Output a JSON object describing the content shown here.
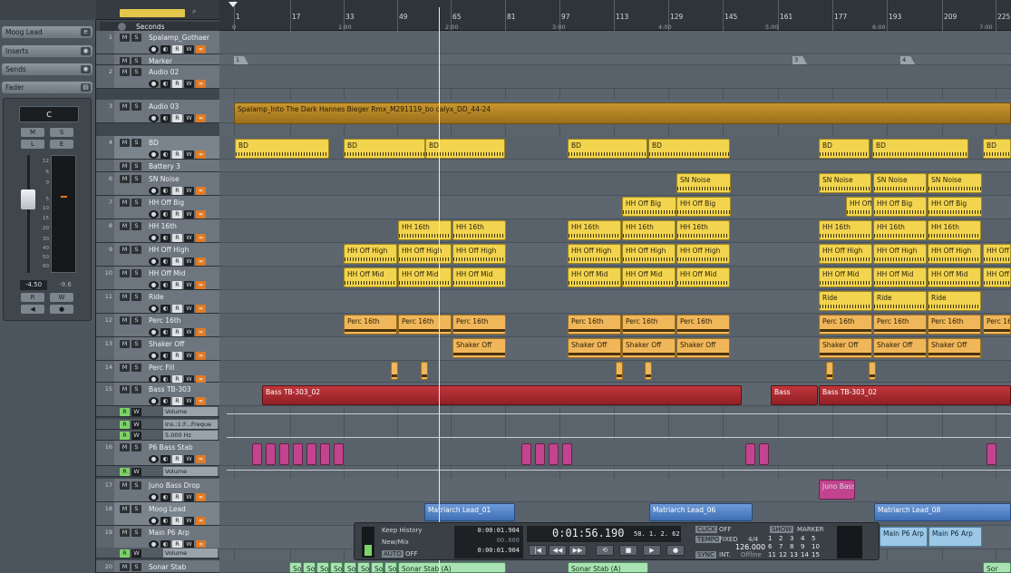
{
  "inspector": {
    "track_name": "Moog Lead",
    "sections": [
      "Inserts",
      "Sends",
      "Fader"
    ],
    "pan_value": "C",
    "mute": "M",
    "solo": "S",
    "listen": "L",
    "edit": "E",
    "scale": [
      "12",
      "6",
      "0",
      "5",
      "10",
      "15",
      "20",
      "30",
      "40",
      "50",
      "60"
    ],
    "volume_value": "-4.50",
    "peak_value": "-9.6",
    "read": "R",
    "write": "W",
    "level_percent": 45
  },
  "toolbar": {
    "seconds_label": "Seconds"
  },
  "ruler": {
    "bars": [
      "1",
      "17",
      "33",
      "49",
      "65",
      "81",
      "97",
      "113",
      "129",
      "145",
      "161",
      "177",
      "193",
      "209",
      "225"
    ],
    "seconds": [
      "0",
      "1:00",
      "2:00",
      "3:00",
      "4:00",
      "5:00",
      "6:00",
      "7:00"
    ]
  },
  "tracks": [
    {
      "num": "1",
      "name": "Spalamp_Gothaer",
      "sel": false
    },
    {
      "num": "",
      "name": "Marker",
      "sel": false
    },
    {
      "num": "2",
      "name": "Audio 02",
      "sel": false
    },
    {
      "num": "3",
      "name": "Audio 03",
      "sel": false
    },
    {
      "num": "4",
      "name": "BD",
      "sel": true
    },
    {
      "num": "",
      "name": "Battery 3",
      "sel": false
    },
    {
      "num": "6",
      "name": "SN Noise",
      "sel": false
    },
    {
      "num": "7",
      "name": "HH Off Big",
      "sel": false
    },
    {
      "num": "8",
      "name": "HH 16th",
      "sel": false
    },
    {
      "num": "9",
      "name": "HH Off High",
      "sel": false
    },
    {
      "num": "10",
      "name": "HH Off Mid",
      "sel": false
    },
    {
      "num": "11",
      "name": "Ride",
      "sel": false
    },
    {
      "num": "12",
      "name": "Perc 16th",
      "sel": false
    },
    {
      "num": "13",
      "name": "Shaker Off",
      "sel": false
    },
    {
      "num": "14",
      "name": "Perc Fill",
      "sel": false
    },
    {
      "num": "15",
      "name": "Bass TB-303",
      "sel": false
    },
    {
      "num": "16",
      "name": "P6 Bass Stab",
      "sel": false
    },
    {
      "num": "17",
      "name": "Juno Bass Drop",
      "sel": false
    },
    {
      "num": "18",
      "name": "Moog Lead",
      "sel": true
    },
    {
      "num": "19",
      "name": "Main P6 Arp",
      "sel": false
    },
    {
      "num": "20",
      "name": "Sonar Stab",
      "sel": false
    }
  ],
  "auto_lanes": [
    {
      "label": "Volume"
    },
    {
      "label": "Ins.:1:F...Freque"
    },
    {
      "label": "5.000 Hz"
    },
    {
      "label": "Volume"
    },
    {
      "label": "Volume"
    }
  ],
  "markers": [
    "1",
    "3",
    "4"
  ],
  "parts": {
    "audio03": "Spalamp_Into The Dark Hannes Bieger Rmx_M291119_bo calyx_DD_44-24",
    "bd": "BD",
    "sn": "SN Noise",
    "hhbig": "HH Off Big",
    "hh16": "HH 16th",
    "hhhigh": "HH Off High",
    "hhmid": "HH Off Mid",
    "ride": "Ride",
    "perc": "Perc 16th",
    "shaker": "Shaker Off",
    "bass": "Bass TB-303_02",
    "bass_short": "Bass",
    "juno": "Juno Bass",
    "lead1": "Matriarch Lead_01",
    "lead6": "Matriarch Lead_06",
    "lead8": "Matriarch Lead_08",
    "arp": "Main P6 Arp",
    "sonar": "Sonar Stab (A)",
    "sonar_short": "Sor"
  },
  "transport": {
    "keep_history": "Keep History",
    "new_mix": "New/Mix",
    "auto": "AUTO",
    "auto_state": "OFF",
    "left_locator": "0:00:01.904",
    "zero": "00.000",
    "right_locator": "0:00:01.904",
    "time_main": "0:01:56.190",
    "bars_pos": "58. 1. 2. 62",
    "click": "CLICK",
    "click_state": "OFF",
    "tempo_label": "TEMPO",
    "tempo_mode": "FIXED",
    "signature": "4/4",
    "tempo": "126.000",
    "sync": "SYNC",
    "sync_mode": "INT.",
    "offline": "Offline",
    "show": "SHOW",
    "marker": "MARKER",
    "marker_numbers": [
      "1",
      "2",
      "3",
      "4",
      "5",
      "6",
      "7",
      "8",
      "9",
      "10",
      "11",
      "12",
      "13",
      "14",
      "15"
    ]
  },
  "colors": {
    "event_yellow": "#f3d44f",
    "event_orange": "#f0b75a",
    "event_red": "#b32d32",
    "event_gold": "#c9962e",
    "event_magenta": "#c2448f",
    "event_blue": "#5a88c8",
    "event_green": "#a9e3b3"
  }
}
